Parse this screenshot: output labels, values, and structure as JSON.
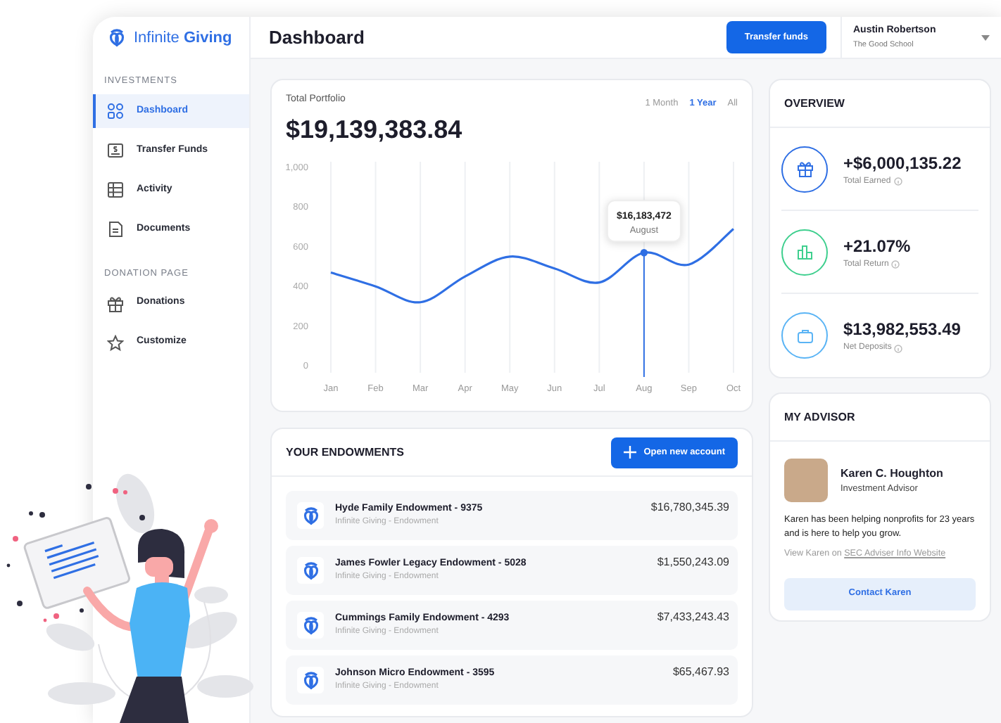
{
  "brand": {
    "name": "Infinite **Giving**"
  },
  "sidebar": {
    "sections": [
      {
        "heading": "INVESTMENTS",
        "items": [
          {
            "label": "Dashboard",
            "selected": true
          },
          {
            "label": "Transfer Funds",
            "selected": false
          },
          {
            "label": "Activity",
            "selected": false
          },
          {
            "label": "Documents",
            "selected": false
          }
        ]
      },
      {
        "heading": "DONATION PAGE",
        "items": [
          {
            "label": "Donations",
            "selected": false
          },
          {
            "label": "Customize",
            "selected": false
          }
        ]
      }
    ]
  },
  "header": {
    "title": "Dashboard",
    "action": "Transfer funds",
    "user": {
      "name": "Austin Robertson",
      "org": "The Good School"
    }
  },
  "portfolio": {
    "label": "Total Portfolio",
    "total": "$19,139,383.84",
    "ranges": [
      {
        "label": "1 Month",
        "selected": false
      },
      {
        "label": "1 Year",
        "selected": true
      },
      {
        "label": "All",
        "selected": false
      }
    ],
    "chart_data": {
      "type": "line",
      "categories": [
        "Jan",
        "Feb",
        "Mar",
        "Apr",
        "May",
        "Jun",
        "Jul",
        "Aug",
        "Sep",
        "Oct"
      ],
      "series": [
        {
          "color": "#2f6fe4",
          "values": [
            470,
            400,
            320,
            450,
            550,
            490,
            420,
            570,
            510,
            690
          ]
        }
      ],
      "ylim": [
        0,
        1000
      ],
      "yticks": [
        0,
        200,
        400,
        600,
        800,
        {
          "value": 1000,
          "label": "1,000"
        }
      ],
      "grid": true,
      "ref_lines": [
        {
          "axis": "x",
          "value": "Aug",
          "color": "#2f6fe4"
        }
      ],
      "annotations": [
        "$16,183,472",
        "August"
      ]
    }
  },
  "endowments": {
    "title": "YOUR ENDOWMENTS",
    "button": "Open new account",
    "items": [
      {
        "name": "Hyde Family Endowment - 9375",
        "subtitle": "Infinite Giving - Endowment",
        "amount": "$16,780,345.39"
      },
      {
        "name": "James Fowler Legacy Endowment - 5028",
        "subtitle": "Infinite Giving - Endowment",
        "amount": "$1,550,243.09"
      },
      {
        "name": "Cummings Family Endowment - 4293",
        "subtitle": "Infinite Giving - Endowment",
        "amount": "$7,433,243.43"
      },
      {
        "name": "Johnson Micro Endowment - 3595",
        "subtitle": "Infinite Giving - Endowment",
        "amount": "$65,467.93"
      }
    ]
  },
  "overview": {
    "title": "OVERVIEW",
    "items": [
      {
        "value": "+$6,000,135.22",
        "label": "Total Earned",
        "color": "#2f6fe4"
      },
      {
        "value": "+21.07%",
        "label": "Total Return",
        "color": "#3ecf8e"
      },
      {
        "value": "$13,982,553.49",
        "label": "Net Deposits",
        "color": "#5ab4f5"
      }
    ]
  },
  "advisor": {
    "title": "MY ADVISOR",
    "name": "Karen C. Houghton",
    "role": "Investment Advisor",
    "bio": "Karen has been helping nonprofits for 23 years and is here to help you grow.",
    "link_prefix": "View Karen on",
    "link": "SEC Adviser Info Website",
    "button": "Contact Karen"
  }
}
